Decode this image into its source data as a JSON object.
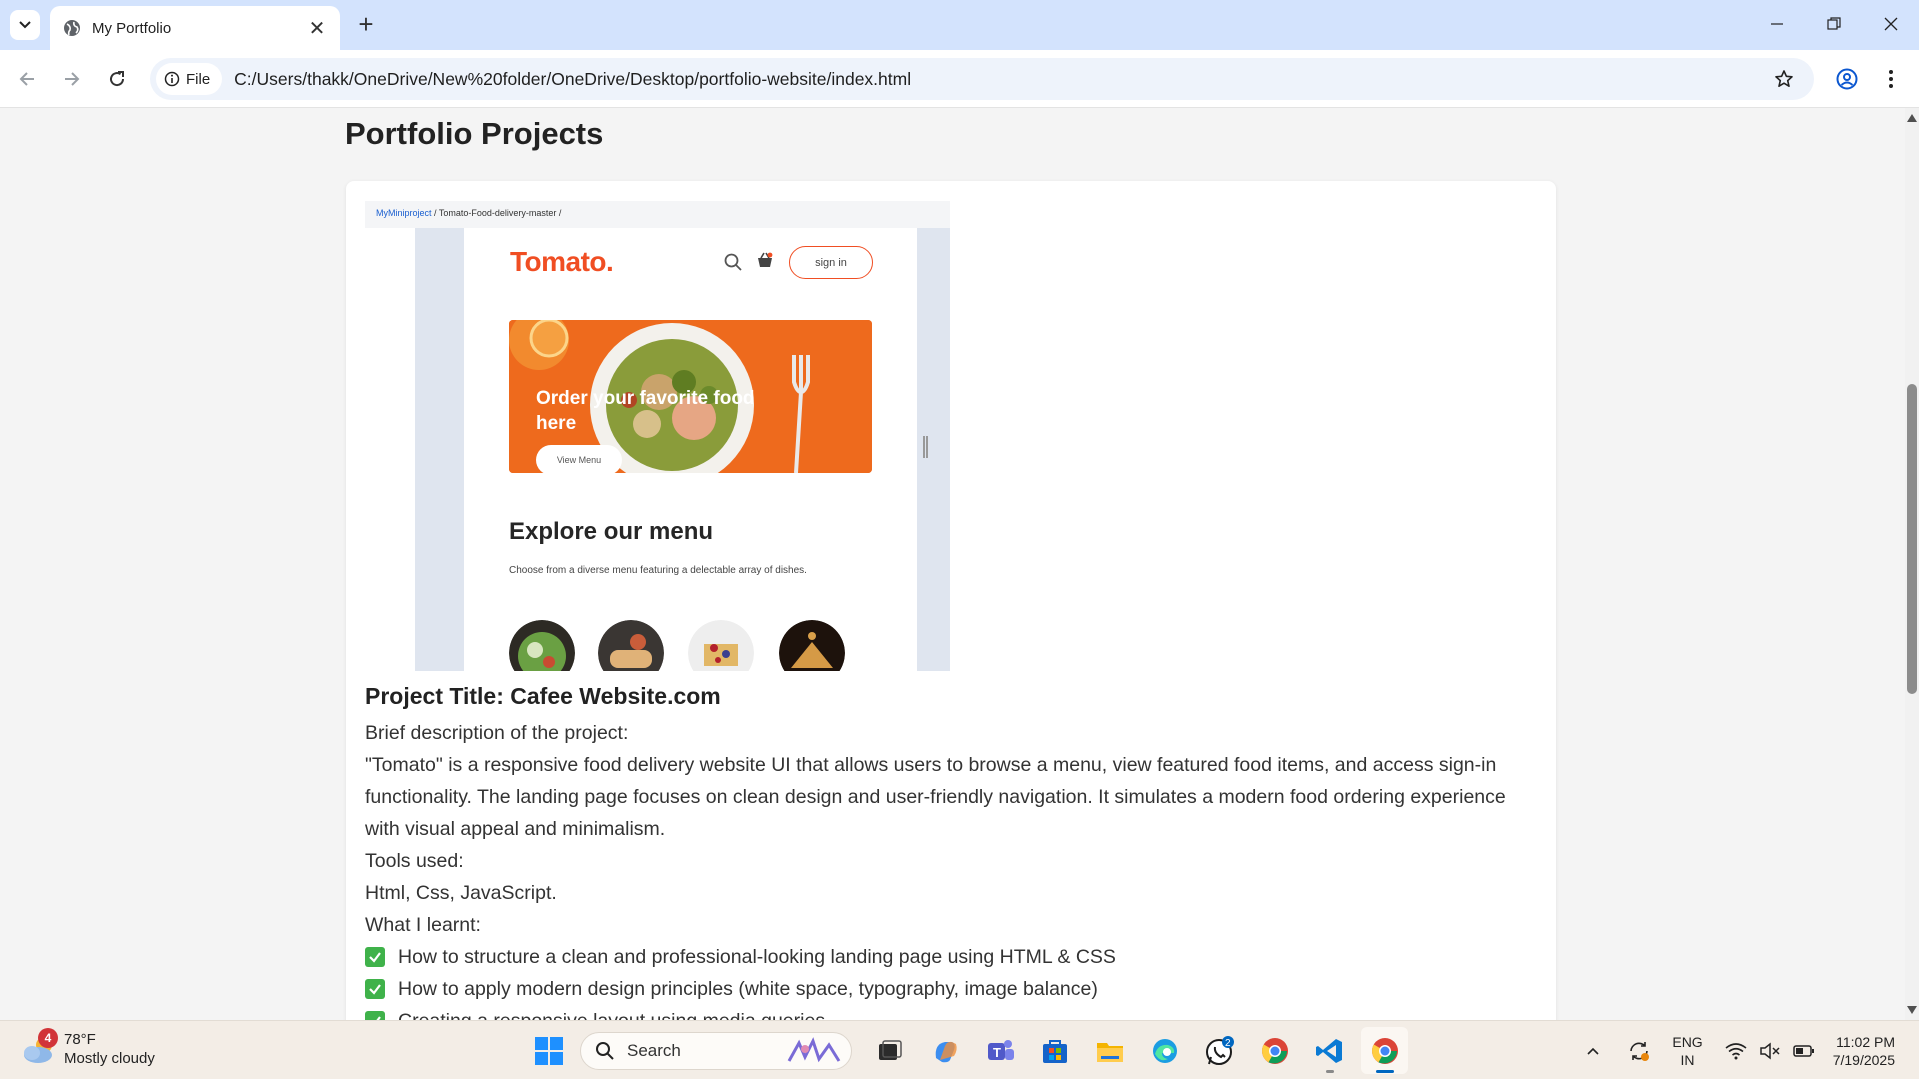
{
  "browser": {
    "tab_title": "My Portfolio",
    "site_chip_label": "File",
    "url": "C:/Users/thakk/OneDrive/New%20folder/OneDrive/Desktop/portfolio-website/index.html"
  },
  "page": {
    "section_title": "Portfolio Projects",
    "project": {
      "screenshot": {
        "breadcrumb_link": "MyMiniproject",
        "breadcrumb_sep1": " / ",
        "breadcrumb_folder": "Tomato-Food-delivery-master",
        "breadcrumb_sep2": " /",
        "logo": "Tomato.",
        "signin_label": "sign in",
        "hero_text": "Order your favorite food here",
        "hero_button": "View Menu",
        "explore_title": "Explore our menu",
        "explore_subtitle": "Choose from a diverse menu featuring a delectable array of dishes."
      },
      "title": "Project Title: Cafee Website.com",
      "description_label": "Brief description of the project:",
      "description": "\"Tomato\" is a responsive food delivery website UI that allows users to browse a menu, view featured food items, and access sign-in functionality. The landing page focuses on clean design and user-friendly navigation. It simulates a modern food ordering experience with visual appeal and minimalism.",
      "tools_label": "Tools used:",
      "tools": "Html, Css, JavaScript.",
      "learnt_label": "What I learnt:",
      "learnt": [
        "How to structure a clean and professional-looking landing page using HTML & CSS",
        "How to apply modern design principles (white space, typography, image balance)",
        "Creating a responsive layout using media queries"
      ]
    }
  },
  "taskbar": {
    "weather_badge": "4",
    "temperature": "78°F",
    "condition": "Mostly cloudy",
    "search_placeholder": "Search",
    "whatsapp_badge": "2",
    "lang_line1": "ENG",
    "lang_line2": "IN",
    "time": "11:02 PM",
    "date": "7/19/2025"
  }
}
